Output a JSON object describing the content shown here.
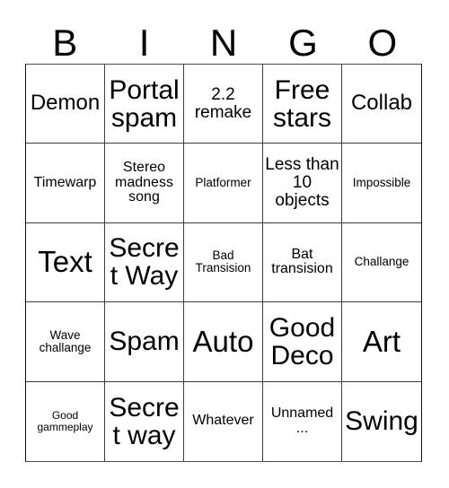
{
  "card": {
    "header_letters": [
      "B",
      "I",
      "N",
      "G",
      "O"
    ],
    "cells": [
      {
        "text": "Demon",
        "size": "md"
      },
      {
        "text": "Portal spam",
        "size": "xl"
      },
      {
        "text": "2.2 remake",
        "size": "sm"
      },
      {
        "text": "Free stars",
        "size": "xl"
      },
      {
        "text": "Collab",
        "size": "md"
      },
      {
        "text": "Timewarp",
        "size": "xs"
      },
      {
        "text": "Stereo madness song",
        "size": "xs"
      },
      {
        "text": "Platformer",
        "size": "xxs"
      },
      {
        "text": "Less than 10 objects",
        "size": "sm"
      },
      {
        "text": "Impossible",
        "size": "xxs"
      },
      {
        "text": "Text",
        "size": "xxl"
      },
      {
        "text": "Secret Way",
        "size": "xl"
      },
      {
        "text": "Bad Transision",
        "size": "xxs"
      },
      {
        "text": "Bat transision",
        "size": "xs"
      },
      {
        "text": "Challange",
        "size": "xxs"
      },
      {
        "text": "Wave challange",
        "size": "xxs"
      },
      {
        "text": "Spam",
        "size": "xl"
      },
      {
        "text": "Auto",
        "size": "xxl"
      },
      {
        "text": "Good Deco",
        "size": "xl"
      },
      {
        "text": "Art",
        "size": "xxl"
      },
      {
        "text": "Good gammeplay",
        "size": "tiny"
      },
      {
        "text": "Secret way",
        "size": "xl"
      },
      {
        "text": "Whatever",
        "size": "xs"
      },
      {
        "text": "Unnamed ...",
        "size": "xs"
      },
      {
        "text": "Swing",
        "size": "xl"
      }
    ]
  }
}
